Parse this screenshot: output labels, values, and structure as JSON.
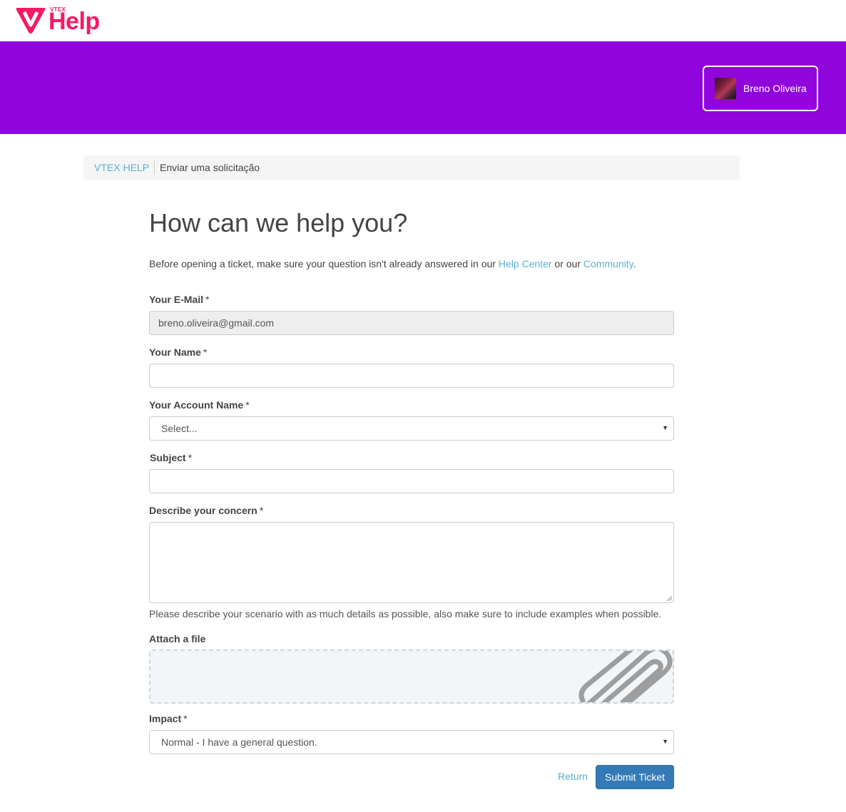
{
  "header": {
    "logo_small": "VTEX",
    "logo_main": "Help",
    "brand_color": "#f71963",
    "hero_color": "#9005dc",
    "user": {
      "name": "Breno Oliveira",
      "avatar_icon": "user-avatar"
    }
  },
  "breadcrumb": {
    "items": [
      {
        "label": "VTEX HELP"
      },
      {
        "label": "Enviar uma solicitação"
      }
    ]
  },
  "page": {
    "title": "How can we help you?",
    "intro": {
      "before": "Before opening a ticket, make sure your question isn't already answered in our ",
      "help_center": "Help Center",
      "middle": " or our ",
      "community": "Community",
      "after": "."
    }
  },
  "form": {
    "email": {
      "label": "Your E-Mail",
      "required": "*",
      "value": "breno.oliveira@gmail.com"
    },
    "name": {
      "label": "Your Name",
      "required": "*",
      "value": ""
    },
    "account": {
      "label": "Your Account Name",
      "required": "*",
      "value": "Select..."
    },
    "subject": {
      "label": "Subject",
      "required": "*",
      "value": ""
    },
    "concern": {
      "label": "Describe your concern",
      "required": "*",
      "value": "",
      "hint": "Please describe your scenario with as much details as possible, also make sure to include examples when possible."
    },
    "attach": {
      "label": "Attach a file",
      "icon": "paperclip-icon"
    },
    "impact": {
      "label": "Impact",
      "required": "*",
      "value": "Normal - I have a general question."
    }
  },
  "actions": {
    "return_label": "Return",
    "submit_label": "Submit Ticket",
    "submit_color": "#337ab7"
  }
}
